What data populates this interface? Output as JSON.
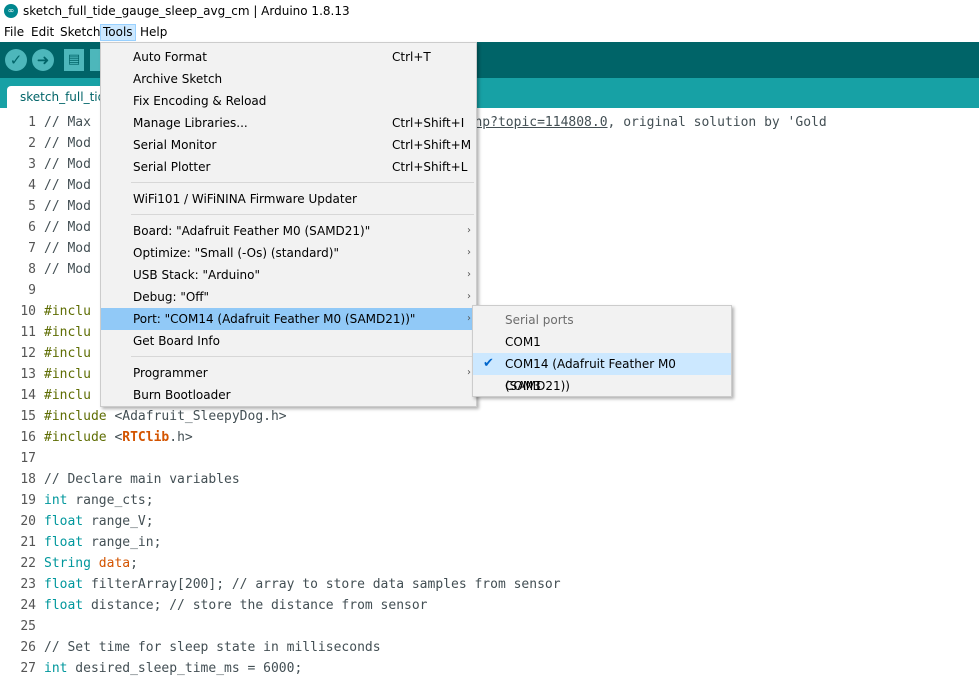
{
  "window": {
    "title": "sketch_full_tide_gauge_sleep_avg_cm | Arduino 1.8.13"
  },
  "menubar": [
    "File",
    "Edit",
    "Sketch",
    "Tools",
    "Help"
  ],
  "toolbar": {
    "verify_icon": "check-icon",
    "upload_icon": "arrow-right-icon",
    "new_icon": "document-icon"
  },
  "tab": {
    "label": "sketch_full_tide"
  },
  "tools_menu": {
    "items": [
      {
        "label": "Auto Format",
        "shortcut": "Ctrl+T"
      },
      {
        "label": "Archive Sketch",
        "shortcut": ""
      },
      {
        "label": "Fix Encoding & Reload",
        "shortcut": ""
      },
      {
        "label": "Manage Libraries...",
        "shortcut": "Ctrl+Shift+I"
      },
      {
        "label": "Serial Monitor",
        "shortcut": "Ctrl+Shift+M"
      },
      {
        "label": "Serial Plotter",
        "shortcut": "Ctrl+Shift+L"
      },
      {
        "label": "WiFi101 / WiFiNINA Firmware Updater",
        "shortcut": ""
      },
      {
        "label": "Board: \"Adafruit Feather M0 (SAMD21)\"",
        "shortcut": ""
      },
      {
        "label": "Optimize: \"Small (-Os) (standard)\"",
        "shortcut": ""
      },
      {
        "label": "USB Stack: \"Arduino\"",
        "shortcut": ""
      },
      {
        "label": "Debug: \"Off\"",
        "shortcut": ""
      },
      {
        "label": "Port: \"COM14 (Adafruit Feather M0 (SAMD21))\"",
        "shortcut": ""
      },
      {
        "label": "Get Board Info",
        "shortcut": ""
      },
      {
        "label": "Programmer",
        "shortcut": ""
      },
      {
        "label": "Burn Bootloader",
        "shortcut": ""
      }
    ]
  },
  "port_menu": {
    "header": "Serial ports",
    "items": [
      {
        "label": "COM1"
      },
      {
        "label": "COM14 (Adafruit Feather M0 (SAMD21))"
      },
      {
        "label": "COM3"
      }
    ]
  },
  "code": {
    "lines": [
      {
        "n": "1",
        "parts": [
          {
            "t": "// Max",
            "c": "cmt"
          },
          {
            "t": "                                      ",
            "c": ""
          },
          {
            "t": ".cc/index.php?topic=114808.0",
            "c": "cmt link"
          },
          {
            "t": ", original solution by 'Gold",
            "c": "cmt"
          }
        ]
      },
      {
        "n": "2",
        "parts": [
          {
            "t": "// Mod",
            "c": "cmt"
          }
        ]
      },
      {
        "n": "3",
        "parts": [
          {
            "t": "// Mod",
            "c": "cmt"
          }
        ]
      },
      {
        "n": "4",
        "parts": [
          {
            "t": "// Mod",
            "c": "cmt"
          }
        ]
      },
      {
        "n": "5",
        "parts": [
          {
            "t": "// Mod",
            "c": "cmt"
          }
        ]
      },
      {
        "n": "6",
        "parts": [
          {
            "t": "// Mod",
            "c": "cmt"
          }
        ]
      },
      {
        "n": "7",
        "parts": [
          {
            "t": "// Mod",
            "c": "cmt"
          }
        ]
      },
      {
        "n": "8",
        "parts": [
          {
            "t": "// Mod",
            "c": "cmt"
          }
        ]
      },
      {
        "n": "9",
        "parts": []
      },
      {
        "n": "10",
        "parts": [
          {
            "t": "#inclu",
            "c": "inc"
          }
        ]
      },
      {
        "n": "11",
        "parts": [
          {
            "t": "#inclu",
            "c": "inc"
          }
        ]
      },
      {
        "n": "12",
        "parts": [
          {
            "t": "#inclu",
            "c": "inc"
          }
        ]
      },
      {
        "n": "13",
        "parts": [
          {
            "t": "#inclu",
            "c": "inc"
          }
        ]
      },
      {
        "n": "14",
        "parts": [
          {
            "t": "#inclu",
            "c": "inc"
          }
        ]
      },
      {
        "n": "15",
        "parts": [
          {
            "t": "#include",
            "c": "inc"
          },
          {
            "t": " <Adafruit_SleepyDog.h>",
            "c": ""
          }
        ]
      },
      {
        "n": "16",
        "parts": [
          {
            "t": "#include",
            "c": "inc"
          },
          {
            "t": " <",
            "c": ""
          },
          {
            "t": "RTClib",
            "c": "lib"
          },
          {
            "t": ".h>",
            "c": ""
          }
        ]
      },
      {
        "n": "17",
        "parts": []
      },
      {
        "n": "18",
        "parts": [
          {
            "t": "// Declare main variables",
            "c": "cmt"
          }
        ]
      },
      {
        "n": "19",
        "parts": [
          {
            "t": "int",
            "c": "type"
          },
          {
            "t": " range_cts;",
            "c": ""
          }
        ]
      },
      {
        "n": "20",
        "parts": [
          {
            "t": "float",
            "c": "type"
          },
          {
            "t": " range_V;",
            "c": ""
          }
        ]
      },
      {
        "n": "21",
        "parts": [
          {
            "t": "float",
            "c": "type"
          },
          {
            "t": " range_in;",
            "c": ""
          }
        ]
      },
      {
        "n": "22",
        "parts": [
          {
            "t": "String",
            "c": "type"
          },
          {
            "t": " ",
            "c": ""
          },
          {
            "t": "data",
            "c": "kw"
          },
          {
            "t": ";",
            "c": ""
          }
        ]
      },
      {
        "n": "23",
        "parts": [
          {
            "t": "float",
            "c": "type"
          },
          {
            "t": " filterArray[200]; // array to store data samples from sensor",
            "c": ""
          }
        ]
      },
      {
        "n": "24",
        "parts": [
          {
            "t": "float",
            "c": "type"
          },
          {
            "t": " distance; // store the distance from sensor",
            "c": ""
          }
        ]
      },
      {
        "n": "25",
        "parts": []
      },
      {
        "n": "26",
        "parts": [
          {
            "t": "// Set time for sleep state in milliseconds",
            "c": "cmt"
          }
        ]
      },
      {
        "n": "27",
        "parts": [
          {
            "t": "int",
            "c": "type"
          },
          {
            "t": " desired_sleep_time_ms = 6000;",
            "c": ""
          }
        ]
      }
    ]
  }
}
